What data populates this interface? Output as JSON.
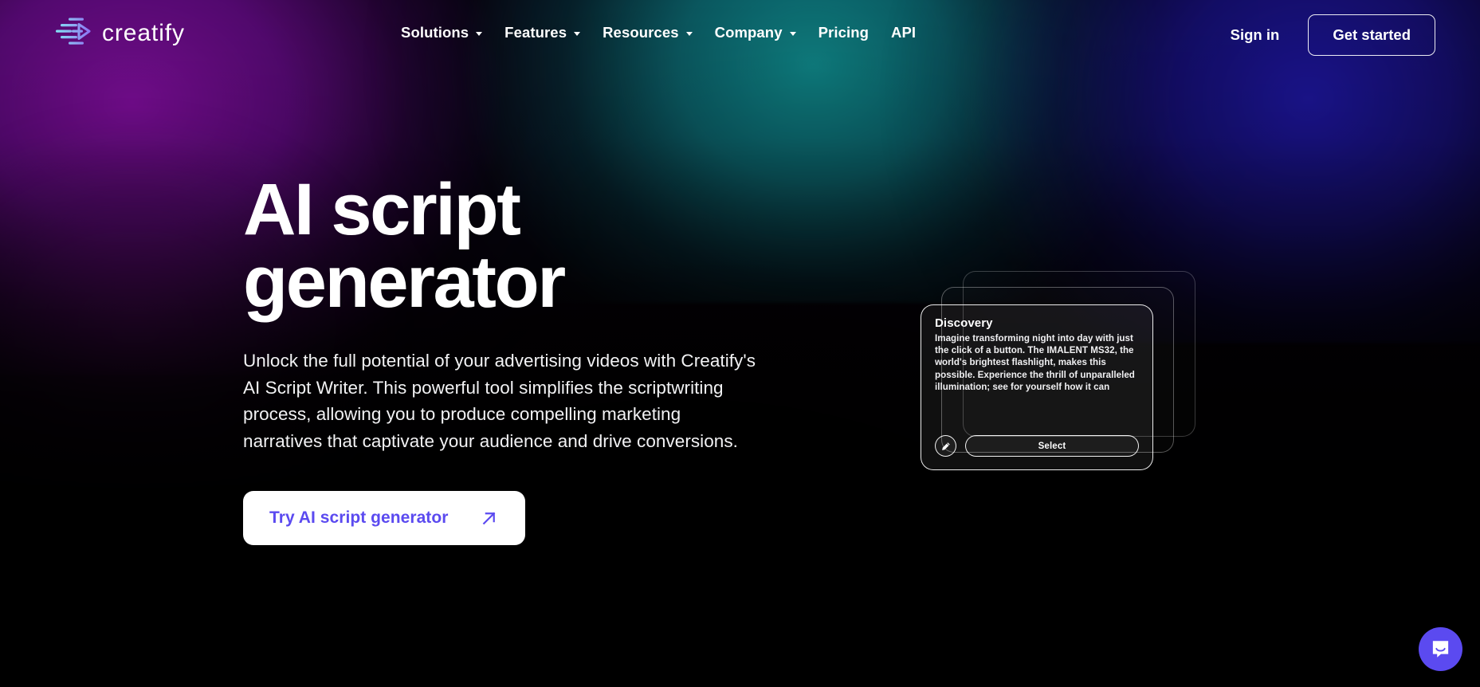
{
  "brand": {
    "name": "creatify",
    "logo_icon": "creatify-arrow-logo-icon",
    "accent_purple": "#5b4af0",
    "gradient_purple": "#7a0e96",
    "gradient_teal": "#0f8486",
    "gradient_navy": "#1e16a0"
  },
  "header": {
    "nav_items": [
      {
        "label": "Solutions",
        "has_dropdown": true
      },
      {
        "label": "Features",
        "has_dropdown": true
      },
      {
        "label": "Resources",
        "has_dropdown": true
      },
      {
        "label": "Company",
        "has_dropdown": true
      },
      {
        "label": "Pricing",
        "has_dropdown": false
      },
      {
        "label": "API",
        "has_dropdown": false
      }
    ],
    "sign_in_label": "Sign in",
    "get_started_label": "Get started"
  },
  "hero": {
    "title_line1": "AI script",
    "title_line2": "generator",
    "subtitle": "Unlock the full potential of your advertising videos with Creatify's AI Script Writer. This powerful tool simplifies the scriptwriting process, allowing you to produce compelling marketing narratives that captivate your audience and drive conversions.",
    "cta_label": "Try AI script generator",
    "cta_icon": "arrow-up-right-icon"
  },
  "script_card": {
    "title": "Discovery",
    "body": "Imagine transforming night into day with just the click of a button. The IMALENT MS32, the world's brightest flashlight, makes this possible. Experience the thrill of unparalleled illumination; see for yourself how it can",
    "edit_icon": "pencil-edit-icon",
    "select_label": "Select",
    "stack_count": 3
  },
  "chat": {
    "icon": "chat-bubble-smile-icon",
    "color": "#5b4af0"
  }
}
